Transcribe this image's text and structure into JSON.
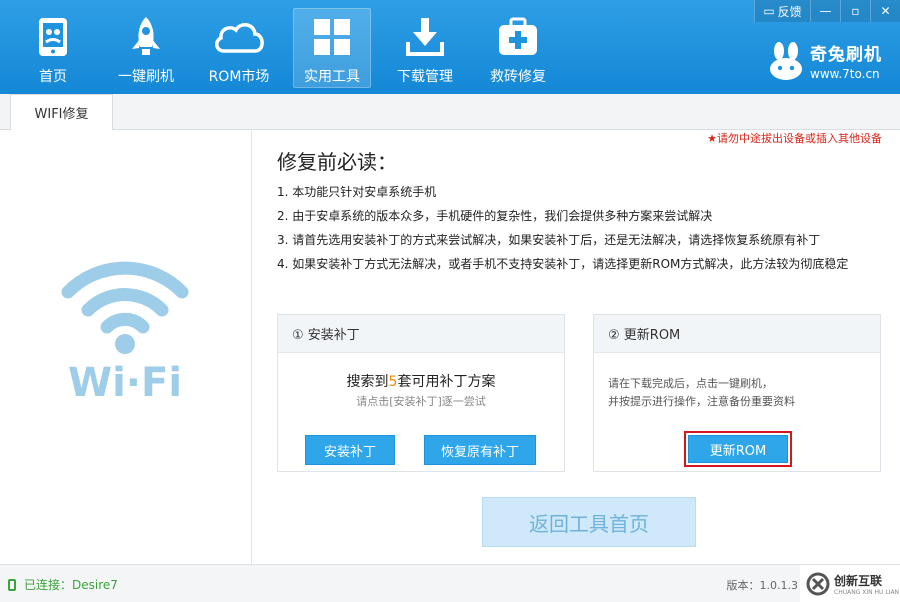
{
  "nav": [
    {
      "label": "首页",
      "icon": "phone-home-icon"
    },
    {
      "label": "一键刷机",
      "icon": "rocket-icon"
    },
    {
      "label": "ROM市场",
      "icon": "cloud-icon"
    },
    {
      "label": "实用工具",
      "icon": "grid-icon",
      "active": true
    },
    {
      "label": "下载管理",
      "icon": "download-icon"
    },
    {
      "label": "救砖修复",
      "icon": "first-aid-kit-icon"
    }
  ],
  "window": {
    "feedback": "反馈",
    "minimize": "—",
    "restore": "▫",
    "close": "✕"
  },
  "brand": {
    "name": "奇兔刷机",
    "url": "www.7to.cn"
  },
  "tab": {
    "label": "WIFI修复"
  },
  "warning": "★请勿中途拔出设备或插入其他设备",
  "title": "修复前必读：",
  "notes": [
    "1. 本功能只针对安卓系统手机",
    "2. 由于安卓系统的版本众多，手机硬件的复杂性，我们会提供多种方案来尝试解决",
    "3. 请首先选用安装补丁的方式来尝试解决，如果安装补丁后，还是无法解决，请选择恢复系统原有补丁",
    "4. 如果安装补丁方式无法解决，或者手机不支持安装补丁，请选择更新ROM方式解决，此方法较为彻底稳定"
  ],
  "card_patch": {
    "heading": "① 安装补丁",
    "found_prefix": "搜索到",
    "found_count": "5",
    "found_suffix": "套可用补丁方案",
    "hint": "请点击[安装补丁]逐一尝试",
    "install_label": "安装补丁",
    "restore_label": "恢复原有补丁"
  },
  "card_rom": {
    "heading": "② 更新ROM",
    "line1": "请在下载完成后，点击一键刷机，",
    "line2": "并按提示进行操作，注意备份重要资料",
    "button_label": "更新ROM"
  },
  "return_label": "返回工具首页",
  "wifi_logo": "Wi·Fi",
  "status": {
    "connected": "已连接：Desire7",
    "version": "版本：1.0.1.3"
  },
  "watermark": {
    "name": "创新互联",
    "sub": "CHUANG XIN HU LIAN"
  },
  "colors": {
    "header": "#1f93de",
    "accent_button": "#2fa6ea",
    "highlight_border": "#d6161d",
    "warning": "#d7261a",
    "count": "#f08a00"
  }
}
